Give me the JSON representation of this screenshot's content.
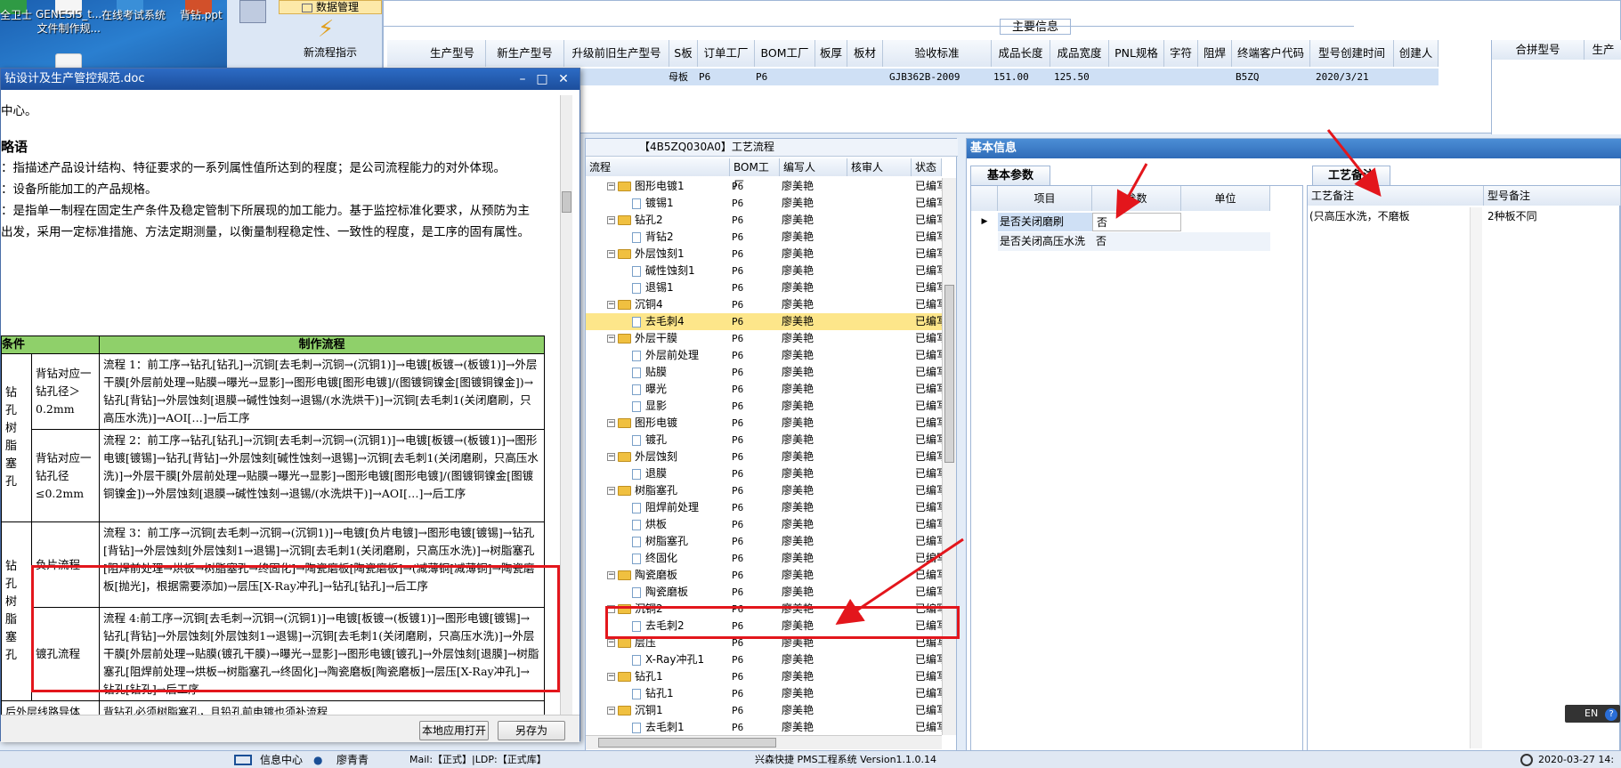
{
  "desktop": {
    "icons": [
      {
        "label": "全卫士"
      },
      {
        "label": "GENESIS_t...\n文件制作规..."
      },
      {
        "label": "在线考试系统"
      },
      {
        "label": "背钻.ppt"
      }
    ]
  },
  "mes": {
    "ribbon_top": "数据管理",
    "new_flow": "新流程指示",
    "main_info_title": "主要信息",
    "main_columns": [
      "生产型号",
      "新生产型号",
      "升级前旧生产型号",
      "S板",
      "订单工厂",
      "BOM工厂",
      "板厚",
      "板材",
      "验收标准",
      "成品长度",
      "成品宽度",
      "PNL规格",
      "字符",
      "阻焊",
      "终端客户代码",
      "型号创建时间",
      "创建人"
    ],
    "main_row": {
      "s_board": "母板",
      "order_factory": "P6",
      "bom_factory": "P6",
      "standard": "GJB362B-2009",
      "length": "151.00",
      "width": "125.50",
      "customer": "B5ZQ",
      "created": "2020/3/21"
    },
    "right_columns": [
      "合拼型号",
      "生产"
    ],
    "process_title": "【4B5ZQ030A0】工艺流程",
    "process_columns": [
      "流程",
      "BOM工厂",
      "编写人",
      "核审人",
      "状态"
    ],
    "process_rows": [
      {
        "kind": "folder",
        "name": "图形电镀1",
        "factory": "P6",
        "author": "廖美艳",
        "status": "已编写"
      },
      {
        "kind": "file",
        "name": "镀锡1",
        "factory": "P6",
        "author": "廖美艳",
        "status": "已编写"
      },
      {
        "kind": "folder",
        "name": "钻孔2",
        "factory": "P6",
        "author": "廖美艳",
        "status": "已编写"
      },
      {
        "kind": "file",
        "name": "背钻2",
        "factory": "P6",
        "author": "廖美艳",
        "status": "已编写"
      },
      {
        "kind": "folder",
        "name": "外层蚀刻1",
        "factory": "P6",
        "author": "廖美艳",
        "status": "已编写"
      },
      {
        "kind": "file",
        "name": "碱性蚀刻1",
        "factory": "P6",
        "author": "廖美艳",
        "status": "已编写"
      },
      {
        "kind": "file",
        "name": "退锡1",
        "factory": "P6",
        "author": "廖美艳",
        "status": "已编写"
      },
      {
        "kind": "folder",
        "name": "沉铜4",
        "factory": "P6",
        "author": "廖美艳",
        "status": "已编写"
      },
      {
        "kind": "file",
        "name": "去毛刺4",
        "factory": "P6",
        "author": "廖美艳",
        "status": "已编写"
      },
      {
        "kind": "folder",
        "name": "外层干膜",
        "factory": "P6",
        "author": "廖美艳",
        "status": "已编写"
      },
      {
        "kind": "file",
        "name": "外层前处理",
        "factory": "P6",
        "author": "廖美艳",
        "status": "已编写"
      },
      {
        "kind": "file",
        "name": "贴膜",
        "factory": "P6",
        "author": "廖美艳",
        "status": "已编写"
      },
      {
        "kind": "file",
        "name": "曝光",
        "factory": "P6",
        "author": "廖美艳",
        "status": "已编写"
      },
      {
        "kind": "file",
        "name": "显影",
        "factory": "P6",
        "author": "廖美艳",
        "status": "已编写"
      },
      {
        "kind": "folder",
        "name": "图形电镀",
        "factory": "P6",
        "author": "廖美艳",
        "status": "已编写"
      },
      {
        "kind": "file",
        "name": "镀孔",
        "factory": "P6",
        "author": "廖美艳",
        "status": "已编写"
      },
      {
        "kind": "folder",
        "name": "外层蚀刻",
        "factory": "P6",
        "author": "廖美艳",
        "status": "已编写"
      },
      {
        "kind": "file",
        "name": "退膜",
        "factory": "P6",
        "author": "廖美艳",
        "status": "已编写"
      },
      {
        "kind": "folder",
        "name": "树脂塞孔",
        "factory": "P6",
        "author": "廖美艳",
        "status": "已编写"
      },
      {
        "kind": "file",
        "name": "阻焊前处理",
        "factory": "P6",
        "author": "廖美艳",
        "status": "已编写"
      },
      {
        "kind": "file",
        "name": "烘板",
        "factory": "P6",
        "author": "廖美艳",
        "status": "已编写"
      },
      {
        "kind": "file",
        "name": "树脂塞孔",
        "factory": "P6",
        "author": "廖美艳",
        "status": "已编写"
      },
      {
        "kind": "file",
        "name": "终固化",
        "factory": "P6",
        "author": "廖美艳",
        "status": "已编写"
      },
      {
        "kind": "folder",
        "name": "陶瓷磨板",
        "factory": "P6",
        "author": "廖美艳",
        "status": "已编写"
      },
      {
        "kind": "file",
        "name": "陶瓷磨板",
        "factory": "P6",
        "author": "廖美艳",
        "status": "已编写"
      },
      {
        "kind": "folder",
        "name": "沉铜2",
        "factory": "P6",
        "author": "廖美艳",
        "status": "已编写"
      },
      {
        "kind": "file",
        "name": "去毛刺2",
        "factory": "P6",
        "author": "廖美艳",
        "status": "已编写"
      },
      {
        "kind": "folder",
        "name": "层压",
        "factory": "P6",
        "author": "廖美艳",
        "status": "已编写"
      },
      {
        "kind": "file",
        "name": "X-Ray冲孔1",
        "factory": "P6",
        "author": "廖美艳",
        "status": "已编写"
      },
      {
        "kind": "folder",
        "name": "钻孔1",
        "factory": "P6",
        "author": "廖美艳",
        "status": "已编写"
      },
      {
        "kind": "file",
        "name": "钻孔1",
        "factory": "P6",
        "author": "廖美艳",
        "status": "已编写"
      },
      {
        "kind": "folder",
        "name": "沉铜1",
        "factory": "P6",
        "author": "廖美艳",
        "status": "已编写"
      },
      {
        "kind": "file",
        "name": "去毛刺1",
        "factory": "P6",
        "author": "廖美艳",
        "status": "已编写"
      }
    ],
    "basic_info_title": "基本信息",
    "basic_params_tab": "基本参数",
    "param_columns": [
      "项目",
      "参数",
      "单位"
    ],
    "params": [
      {
        "item": "是否关闭磨刷",
        "value": "否",
        "unit": ""
      },
      {
        "item": "是否关闭高压水洗",
        "value": "否",
        "unit": ""
      }
    ],
    "process_note_tab": "工艺备注",
    "note_columns": [
      "工艺备注",
      "型号备注"
    ],
    "process_note": "(只高压水洗，不磨板",
    "model_note": "2种板不同",
    "ime": "EN"
  },
  "doc": {
    "title": "钻设计及生产管控规范.doc",
    "lines": [
      "中心。",
      "略语",
      "：指描述产品设计结构、特征要求的一系列属性值所达到的程度；是公司流程能力的对外体现。",
      "：设备所能加工的产品规格。",
      "：是指单一制程在固定生产条件及稳定管制下所展现的加工能力。基于监控标准化要求，从预防为主",
      "出发，采用一定标准措施、方法定期测量，以衡量制程稳定性、一致性的程度，是工序的固有属性。"
    ],
    "table_headers": [
      "条件",
      "制作流程"
    ],
    "rows": [
      {
        "group": "",
        "cond": "背钻对应一钻孔径＞0.2mm",
        "flow": "流程 1：前工序→钻孔[钻孔]→沉铜[去毛刺→沉铜→(沉铜1)]→电镀[板镀→(板镀1)]→外层干膜[外层前处理→贴膜→曝光→显影]→图形电镀[图形电镀]/(图镀铜镍金[图镀铜镍金])→钻孔[背钻]→外层蚀刻[退膜→碱性蚀刻→退锡/(水洗烘干)]→沉铜[去毛刺1(关闭磨刷，只高压水洗)]→AOI[…]→后工序"
      },
      {
        "group": "钻孔树脂塞孔",
        "cond": "背钻对应一钻孔径≤0.2mm",
        "flow": "流程 2：前工序→钻孔[钻孔]→沉铜[去毛刺→沉铜→(沉铜1)]→电镀[板镀→(板镀1)]→图形电镀[镀锡]→钻孔[背钻]→外层蚀刻[碱性蚀刻→退锡]→沉铜[去毛刺1(关闭磨刷，只高压水洗)]→外层干膜[外层前处理→贴膜→曝光→显影]→图形电镀[图形电镀]/(图镀铜镍金[图镀铜镍金])→外层蚀刻[退膜→碱性蚀刻→退锡/(水洗烘干)]→AOI[…]→后工序"
      },
      {
        "group": "钻孔树脂塞孔",
        "cond": "负片流程",
        "flow": "流程 3：前工序→沉铜[去毛刺→沉铜→(沉铜1)]→电镀[负片电镀]→图形电镀[镀锡]→钻孔[背钻]→外层蚀刻[外层蚀刻1→退锡]→沉铜[去毛刺1(关闭磨刷，只高压水洗)]→树脂塞孔[阻焊前处理→烘板→树脂塞孔→终固化]→陶瓷磨板[陶瓷磨板]→(减薄铜[减薄铜]→陶瓷磨板[抛光]，根据需要添加)→层压[X-Ray冲孔]→钻孔[钻孔]→后工序"
      },
      {
        "group": "",
        "cond": "镀孔流程",
        "flow": "流程 4:前工序→沉铜[去毛刺→沉铜→(沉铜1)]→电镀[板镀→(板镀1)]→图形电镀[镀锡]→钻孔[背钻]→外层蚀刻[外层蚀刻1→退锡]→沉铜[去毛刺1(关闭磨刷，只高压水洗)]→外层干膜[外层前处理→贴膜(镀孔干膜)→曝光→显影]→图形电镀[镀孔]→外层蚀刻[退膜]→树脂塞孔[阻焊前处理→烘板→树脂塞孔→终固化]→陶瓷磨板[陶瓷磨板]→层压[X-Ray冲孔]→钻孔[钻孔]→后工序"
      }
    ],
    "footer_left": "后外层线路导体",
    "footer_right": "背钻孔必须树脂塞孔，且铅孔前电镀也须补流程",
    "open_local": "本地应用打开",
    "save_as": "另存为"
  },
  "statusbar": {
    "info_center": "信息中心",
    "user": "廖青青",
    "path": "Mail:【正式】|LDP:【正式库】",
    "system": "兴森快捷 PMS工程系统 Version1.1.0.14",
    "time": "2020-03-27 14:"
  },
  "annotation_color": "#e3161c"
}
